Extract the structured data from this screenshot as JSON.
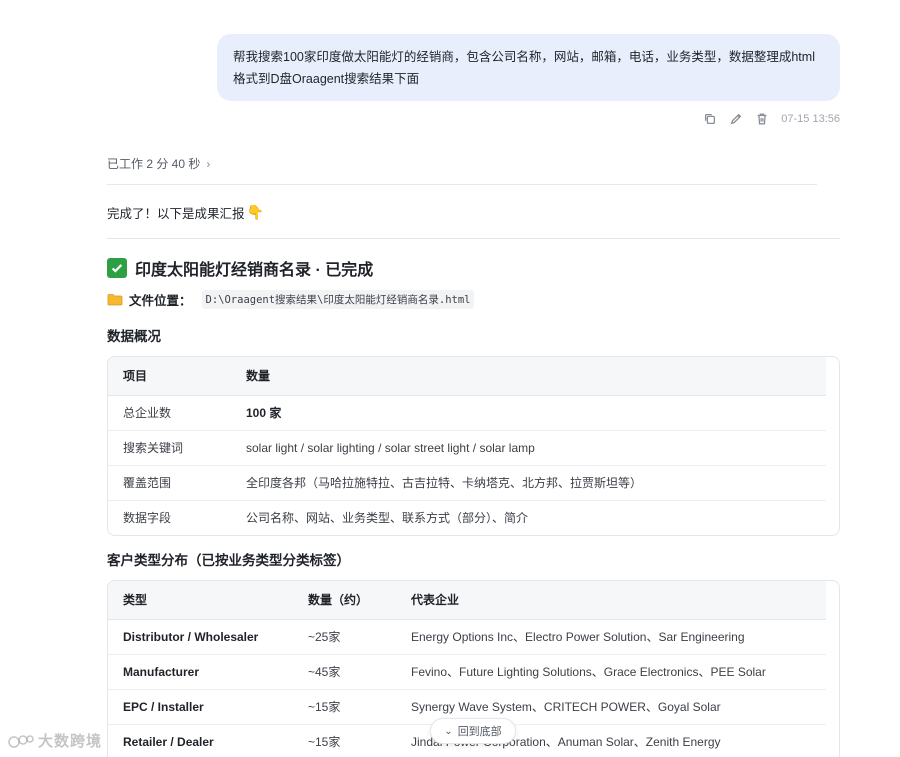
{
  "user_message": {
    "text": "帮我搜索100家印度做太阳能灯的经销商，包含公司名称，网站，邮箱，电话，业务类型，数据整理成html格式到D盘Oraagent搜索结果下面",
    "time": "07-15 13:56"
  },
  "worked": {
    "label": "已工作 2 分 40 秒",
    "chevron": "›"
  },
  "done_line": {
    "text": "完成了！以下是成果汇报",
    "emoji": "👇"
  },
  "report": {
    "title": "印度太阳能灯经销商名录 · 已完成",
    "file_label": "文件位置：",
    "file_path": "D:\\Oraagent搜索结果\\印度太阳能灯经销商名录.html"
  },
  "overview": {
    "heading": "数据概况",
    "headers": [
      "项目",
      "数量"
    ],
    "rows": [
      [
        "总企业数",
        "100 家"
      ],
      [
        "搜索关键词",
        "solar light / solar lighting / solar street light / solar lamp"
      ],
      [
        "覆盖范围",
        "全印度各邦（马哈拉施特拉、古吉拉特、卡纳塔克、北方邦、拉贾斯坦等）"
      ],
      [
        "数据字段",
        "公司名称、网站、业务类型、联系方式（部分）、简介"
      ]
    ]
  },
  "distribution": {
    "heading": "客户类型分布（已按业务类型分类标签）",
    "headers": [
      "类型",
      "数量（约）",
      "代表企业"
    ],
    "rows": [
      [
        "Distributor / Wholesaler",
        "~25家",
        "Energy Options Inc、Electro Power Solution、Sar Engineering"
      ],
      [
        "Manufacturer",
        "~45家",
        "Fevino、Future Lighting Solutions、Grace Electronics、PEE Solar"
      ],
      [
        "EPC / Installer",
        "~15家",
        "Synergy Wave System、CRITECH POWER、Goyal Solar"
      ],
      [
        "Retailer / Dealer",
        "~15家",
        "Jindal Power Corporation、Anuman Solar、Zenith Energy"
      ]
    ]
  },
  "scroll_button": {
    "label": "回到底部",
    "arrow": "⌄"
  },
  "watermark": {
    "text": "大数跨境"
  },
  "colors": {
    "bubble": "#e8eefb",
    "check": "#2ea043",
    "folder": "#f5b82e"
  }
}
